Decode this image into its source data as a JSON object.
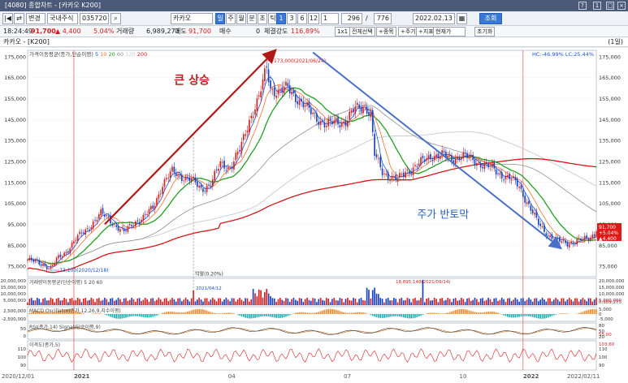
{
  "window": {
    "title": "[4080] 종합차트 - [카카오 K200]",
    "help": "?",
    "btn1": "1",
    "btn2": "□",
    "btn3": "×"
  },
  "toolbar": {
    "nav1": "|◀",
    "nav2": "⇄",
    "mode": "변경",
    "market": "국내주식",
    "code": "035720",
    "search_icon": "⌕",
    "stock_name": "카카오",
    "period_btns": [
      "일",
      "주",
      "월",
      "분",
      "초",
      "틱"
    ],
    "interval_btns": [
      "1",
      "3",
      "6",
      "12"
    ],
    "interval_value": "1",
    "count": "296",
    "total": "776",
    "date": "2022.02.13",
    "query": "조회"
  },
  "pricebar": {
    "time": "18:24:49",
    "price": "91,700",
    "change": "▲ 4,400",
    "rate": "5.04%",
    "vol_label": "거래량",
    "volume": "6,989,273",
    "ask_label": "매도",
    "ask": "91,700",
    "bid_label": "매수",
    "bid": "0",
    "str_label": "체결강도",
    "strength": "116.89%",
    "b1": "1x1",
    "b2": "전체선택",
    "b3": "+종목",
    "b4": "+주기",
    "b5": "+지표",
    "b6": "현재가",
    "b7": "초기화"
  },
  "chart_name": "카카오 - [K200]",
  "unit": "(1일)",
  "colors": {
    "up": "#d42020",
    "down": "#1a3fbf",
    "ma5": "#1a4fd8",
    "ma10": "#f07030",
    "ma20": "#22a022",
    "ma60": "#909090",
    "ma120": "#c8c8d8",
    "ma200": "#d01818",
    "arrow_up": "#b01818",
    "arrow_down": "#4a70c8"
  },
  "chart_data": {
    "type": "candlestick",
    "price_legend": {
      "label": "가격이동평균(종가,단순이평)",
      "periods": [
        "5",
        "10",
        "20",
        "60",
        "120",
        "200"
      ]
    },
    "ylim": [
      70000,
      178000
    ],
    "y_ticks": [
      75000,
      85000,
      95000,
      105000,
      115000,
      125000,
      135000,
      145000,
      155000,
      165000,
      175000
    ],
    "y_tick_labels": [
      "75,000",
      "85,000",
      "95,000",
      "105,000",
      "115,000",
      "125,000",
      "135,000",
      "145,000",
      "155,000",
      "165,000",
      "175,000"
    ],
    "right_ticks": [
      75000,
      85000,
      95000,
      105000,
      115000,
      125000,
      135000,
      145000,
      155000,
      165000,
      175000
    ],
    "x_labels": [
      "2020/12/01",
      "2021",
      "04",
      "07",
      "10",
      "2022",
      "2022/02/11"
    ],
    "max_label": "173,000(2021/06/24)",
    "min_label": "73,100(2020/12/18)",
    "hc_lc": "HC:-46.99%  LC:25.44%",
    "marker_label": "막말(0.20%)",
    "annotation_up": "큰 상승",
    "annotation_down": "주가 반토막",
    "last_price_badge": [
      "91,700",
      "+5.04%",
      "▲4,400"
    ],
    "close_path": [
      [
        0,
        78000
      ],
      [
        4,
        77000
      ],
      [
        8,
        76000
      ],
      [
        12,
        74000
      ],
      [
        15,
        78000
      ],
      [
        20,
        82000
      ],
      [
        25,
        88000
      ],
      [
        30,
        92000
      ],
      [
        34,
        96000
      ],
      [
        38,
        100000
      ],
      [
        42,
        98000
      ],
      [
        46,
        94000
      ],
      [
        50,
        91000
      ],
      [
        55,
        96000
      ],
      [
        60,
        98000
      ],
      [
        65,
        103000
      ],
      [
        70,
        114000
      ],
      [
        75,
        120000
      ],
      [
        80,
        118000
      ],
      [
        85,
        116000
      ],
      [
        90,
        112000
      ],
      [
        95,
        114000
      ],
      [
        100,
        124000
      ],
      [
        105,
        122000
      ],
      [
        110,
        130000
      ],
      [
        115,
        145000
      ],
      [
        120,
        155000
      ],
      [
        124,
        170000
      ],
      [
        126,
        160000
      ],
      [
        130,
        158000
      ],
      [
        135,
        160000
      ],
      [
        140,
        155000
      ],
      [
        145,
        150000
      ],
      [
        150,
        146000
      ],
      [
        155,
        142000
      ],
      [
        160,
        144000
      ],
      [
        165,
        144000
      ],
      [
        170,
        150000
      ],
      [
        175,
        152000
      ],
      [
        178,
        147000
      ],
      [
        180,
        128000
      ],
      [
        184,
        120000
      ],
      [
        188,
        118000
      ],
      [
        192,
        116000
      ],
      [
        196,
        120000
      ],
      [
        200,
        122000
      ],
      [
        205,
        125000
      ],
      [
        210,
        128000
      ],
      [
        215,
        128000
      ],
      [
        220,
        126000
      ],
      [
        225,
        128000
      ],
      [
        230,
        126000
      ],
      [
        235,
        124000
      ],
      [
        240,
        122000
      ],
      [
        245,
        119000
      ],
      [
        250,
        117000
      ],
      [
        255,
        113000
      ],
      [
        260,
        104000
      ],
      [
        265,
        95000
      ],
      [
        270,
        90000
      ],
      [
        275,
        87000
      ],
      [
        280,
        86000
      ],
      [
        285,
        87000
      ],
      [
        290,
        88000
      ],
      [
        296,
        91700
      ]
    ],
    "volume": {
      "label": "거래량이동평균(단순이평)",
      "periods": [
        "5",
        "20",
        "60"
      ],
      "ylim": [
        0,
        20000000
      ],
      "ticks": [
        "20,000,000",
        "15,000,000",
        "10,000,000",
        "5,000,000"
      ],
      "right": [
        "20,000,000",
        "15,000,000",
        "10,000,000",
        "5,000,000"
      ],
      "max_label": "18,895,148(2021/09/14)",
      "mark_label": "2021/04/12",
      "last": "6,989,273"
    },
    "macd": {
      "label": "MACD Oscillator(종가,12,26,9,지수이평)",
      "ticks": [
        "2,500,000",
        "-2,500,000"
      ],
      "right": [
        "5,000",
        "0",
        "-5,000"
      ]
    },
    "rsi": {
      "label": "RSI(종가,14)  Signal(단순이평,9)",
      "ticks": [
        "50",
        "0"
      ],
      "right": [
        "80",
        "50",
        "20"
      ],
      "last": "55.00"
    },
    "disp": {
      "label": "이격도(종가,5)",
      "ticks": [
        "110",
        "100",
        "90"
      ],
      "right": [
        "110",
        "100",
        "90"
      ],
      "last": "103.60"
    }
  }
}
